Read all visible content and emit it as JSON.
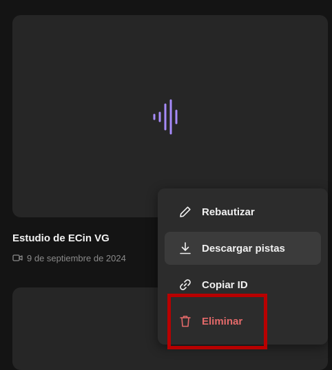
{
  "card": {
    "title": "Estudio de ECin VG",
    "date": "9 de septiembre de 2024"
  },
  "colors": {
    "accent": "#a78bfa",
    "danger": "#e46a6a",
    "highlight_border": "#b80000"
  },
  "menu": {
    "items": [
      {
        "label": "Rebautizar",
        "icon": "pencil-icon"
      },
      {
        "label": "Descargar pistas",
        "icon": "download-icon"
      },
      {
        "label": "Copiar ID",
        "icon": "link-icon"
      },
      {
        "label": "Eliminar",
        "icon": "trash-icon"
      }
    ]
  }
}
